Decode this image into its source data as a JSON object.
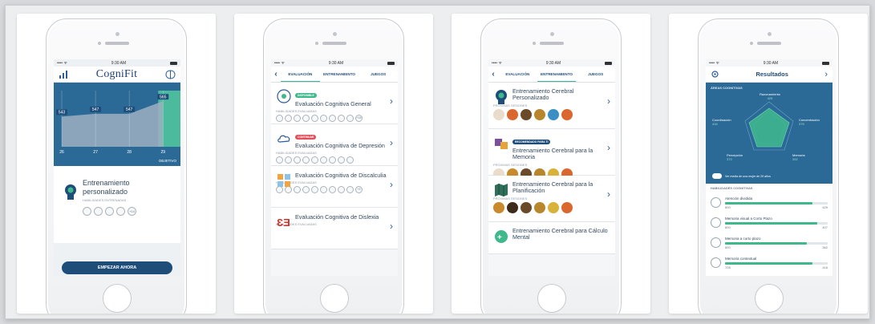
{
  "status": {
    "carrier": "•••• ᯤ",
    "time": "9:30 AM"
  },
  "screen1": {
    "brand": "CogniFit",
    "chart_data": {
      "type": "area",
      "title": "",
      "categories": [
        "26",
        "27",
        "28",
        "29"
      ],
      "values": [
        543,
        547,
        547,
        565
      ],
      "value_labels": [
        "543",
        "547",
        "547",
        "565"
      ],
      "target_label": "OBJETIVO",
      "colors": {
        "bg": "#2b6a97",
        "area": "#9dafc1",
        "target": "#4cba9c"
      }
    },
    "card_title": "Entrenamiento personalizado",
    "skills_label": "HABILIDADES ENTRENADAS",
    "extra": "+14",
    "cta": "EMPEZAR AHORA"
  },
  "screen2": {
    "tabs": [
      "EVALUACIÓN",
      "ENTRENAMIENTO",
      "JUEGOS"
    ],
    "items": [
      {
        "badge": "DISPONIBLE",
        "badge_color": "#3fb88c",
        "title": "Evaluación Cognitiva General",
        "sub": "HABILIDADES EVALUADAS",
        "extra": "+14"
      },
      {
        "badge": "CONTINUAR",
        "badge_color": "#e0505a",
        "title": "Evaluación Cognitiva de Depresión",
        "sub": "HABILIDADES EVALUADAS",
        "extra": ""
      },
      {
        "badge": "",
        "badge_color": "",
        "title": "Evaluación Cognitiva de Discalculia",
        "sub": "HABILIDADES EVALUADAS",
        "extra": "+3"
      },
      {
        "badge": "",
        "badge_color": "",
        "title": "Evaluación Cognitiva de Dislexia",
        "sub": "HABILIDADES EVALUADAS",
        "extra": ""
      }
    ]
  },
  "screen3": {
    "tabs": [
      "EVALUACIÓN",
      "ENTRENAMIENTO",
      "JUEGOS"
    ],
    "items": [
      {
        "badge": "",
        "title": "Entrenamiento Cerebral Personalizado",
        "sub": "PRÓXIMAS SESIONES"
      },
      {
        "badge": "RECOMENDADO PARA TI",
        "title": "Entrenamiento Cerebral para la Memoria",
        "sub": "PRÓXIMAS SESIONES"
      },
      {
        "badge": "",
        "title": "Entrenamiento Cerebral para la Planificación",
        "sub": "PRÓXIMAS SESIONES"
      },
      {
        "badge": "",
        "title": "Entrenamiento Cerebral para Cálculo Mental",
        "sub": ""
      }
    ]
  },
  "screen4": {
    "title": "Resultados",
    "areas_label": "ÁREAS COGNITIVAS",
    "radar_labels": [
      "Razonamiento",
      "Concentración",
      "Memoria",
      "Percepción",
      "Coordinación"
    ],
    "radar_values": [
      "425",
      "375",
      "392",
      "370",
      "416"
    ],
    "toggle_label": "Ver media de una mujer de 29 años",
    "skills_label": "HABILIDADES COGNITIVAS",
    "skills": [
      {
        "name": "Atención dividida",
        "min": "800",
        "score": "429",
        "fill": 0.85
      },
      {
        "name": "Memoria visual a Corto Plazo",
        "min": "800",
        "score": "407",
        "fill": 0.9
      },
      {
        "name": "Memoria a corto plazo",
        "min": "800",
        "score": "362",
        "fill": 0.8
      },
      {
        "name": "Memoria contextual",
        "min": "708",
        "score": "416",
        "fill": 0.85
      }
    ]
  }
}
